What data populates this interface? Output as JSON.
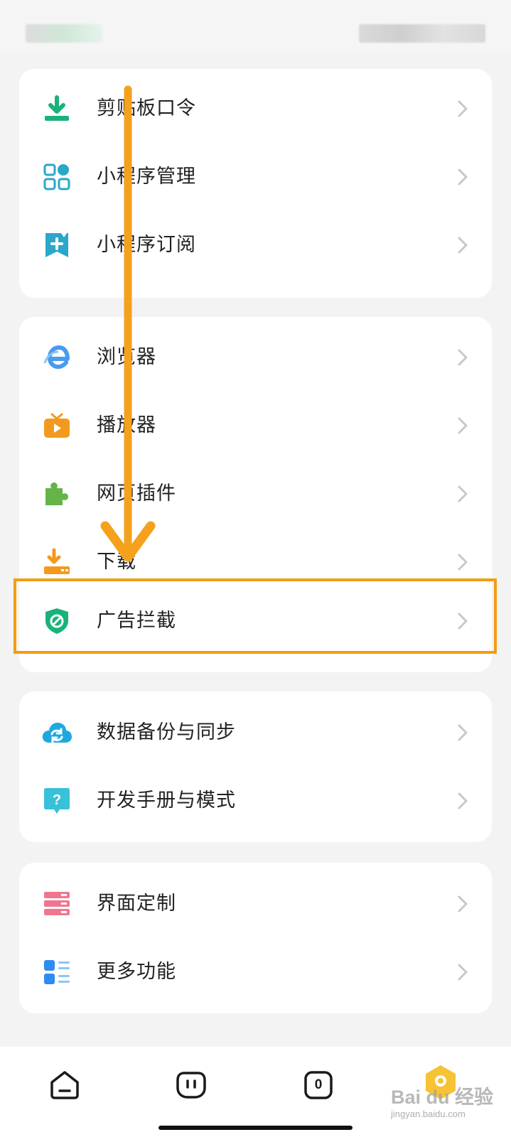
{
  "cards": [
    {
      "items": [
        {
          "name": "clipboard-code",
          "label": "剪贴板口令",
          "icon": "download-tray-icon",
          "color": "#19b37a"
        },
        {
          "name": "mini-program-manage",
          "label": "小程序管理",
          "icon": "grid-apps-icon",
          "color": "#2aa7c9"
        },
        {
          "name": "mini-program-subscribe",
          "label": "小程序订阅",
          "icon": "bookmark-plus-icon",
          "color": "#2aa7c9"
        }
      ]
    },
    {
      "items": [
        {
          "name": "browser",
          "label": "浏览器",
          "icon": "browser-e-icon",
          "color": "#4a9bef"
        },
        {
          "name": "player",
          "label": "播放器",
          "icon": "tv-play-icon",
          "color": "#f39a1e"
        },
        {
          "name": "web-plugins",
          "label": "网页插件",
          "icon": "puzzle-icon",
          "color": "#64b447"
        },
        {
          "name": "download",
          "label": "下载",
          "icon": "download-icon",
          "color": "#f39a1e"
        },
        {
          "name": "ad-block",
          "label": "广告拦截",
          "icon": "shield-block-icon",
          "color": "#19b37a"
        }
      ]
    },
    {
      "items": [
        {
          "name": "backup-sync",
          "label": "数据备份与同步",
          "icon": "cloud-sync-icon",
          "color": "#1fa8e0"
        },
        {
          "name": "dev-manual",
          "label": "开发手册与模式",
          "icon": "question-bubble-icon",
          "color": "#38c1d8"
        }
      ]
    },
    {
      "items": [
        {
          "name": "ui-custom",
          "label": "界面定制",
          "icon": "layers-icon",
          "color": "#f0768e"
        },
        {
          "name": "more-features",
          "label": "更多功能",
          "icon": "list-grid-icon",
          "color": "#2d8cf0"
        }
      ]
    }
  ],
  "bottom_nav": {
    "items": [
      {
        "name": "home",
        "icon": "home-icon"
      },
      {
        "name": "pause",
        "icon": "pause-face-icon"
      },
      {
        "name": "tabs",
        "icon": "tab-count-icon",
        "count": "0"
      },
      {
        "name": "profile",
        "icon": "avatar-icon"
      }
    ]
  },
  "watermark": {
    "line1": "Bai du 经验",
    "line2": "jingyan.baidu.com"
  },
  "colors": {
    "highlight": "#f39c12",
    "arrow": "#f5a11c",
    "chevron": "#c8c8c8"
  }
}
